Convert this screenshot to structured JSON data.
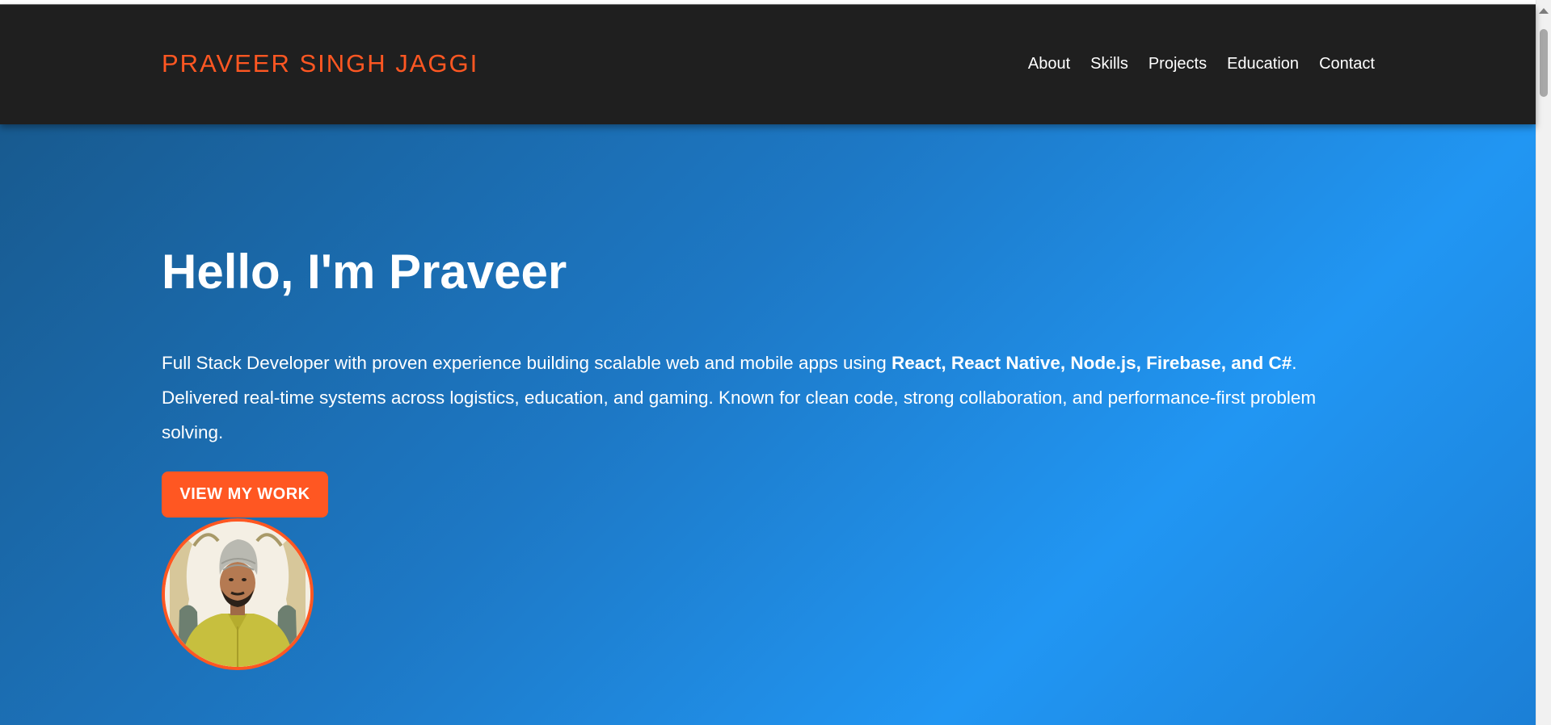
{
  "header": {
    "brand": "PRAVEER SINGH JAGGI",
    "nav": [
      "About",
      "Skills",
      "Projects",
      "Education",
      "Contact"
    ]
  },
  "hero": {
    "title": "Hello, I'm Praveer",
    "description": {
      "intro": "Full Stack Developer with proven experience building scalable web and mobile apps using ",
      "tech": "React, React Native, Node.js, Firebase, and C#",
      "rest": ". Delivered real-time systems across logistics, education, and gaming. Known for clean code, strong collaboration, and performance-first problem solving."
    },
    "cta_label": "VIEW MY WORK"
  },
  "colors": {
    "accent": "#ff5722",
    "header_bg": "#1f1f1f",
    "hero_gradient_start": "#185a8f",
    "hero_gradient_end": "#2196f3"
  },
  "icons": {
    "scroll_up": "triangle-up-icon"
  }
}
